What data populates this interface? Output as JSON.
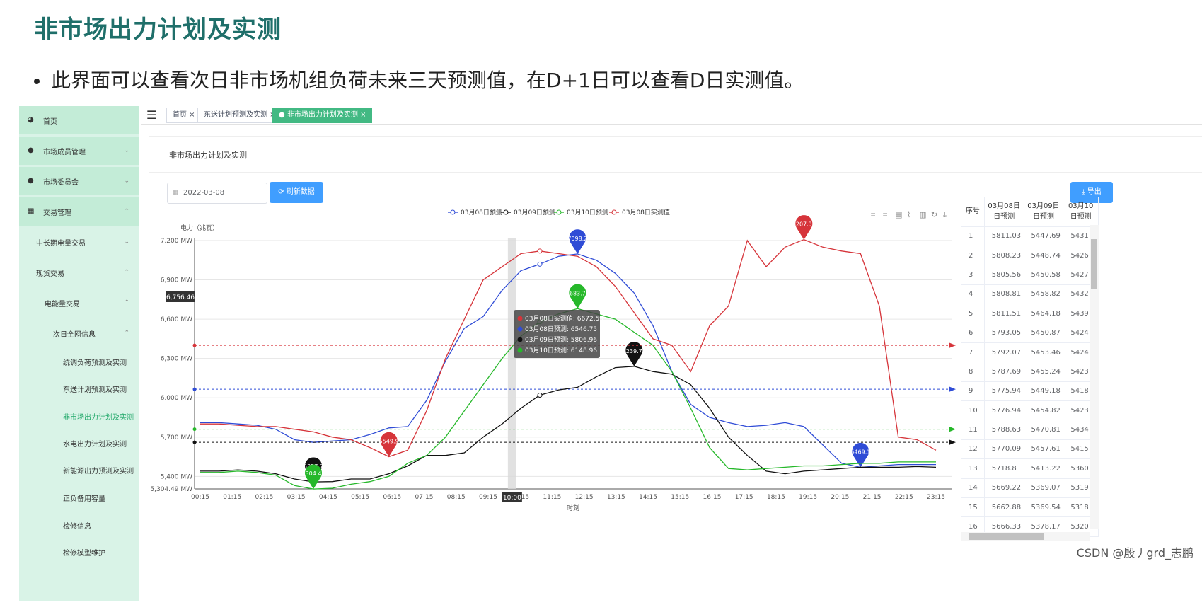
{
  "slide": {
    "title": "非市场出力计划及实测",
    "bullet": "此界面可以查看次日非市场机组负荷未来三天预测值，在D+1日可以查看D日实测值。"
  },
  "sidebar": {
    "items": [
      {
        "label": "首页",
        "icon": "dashboard-icon"
      },
      {
        "label": "市场成员管理",
        "icon": "people-icon",
        "chev": "⌄"
      },
      {
        "label": "市场委员会",
        "icon": "people-icon",
        "chev": "⌄"
      },
      {
        "label": "交易管理",
        "icon": "grid-icon",
        "chev": "⌃"
      },
      {
        "label": "中长期电量交易",
        "chev": "⌄"
      },
      {
        "label": "现货交易",
        "chev": "⌃"
      },
      {
        "label": "电能量交易",
        "chev": "⌃"
      },
      {
        "label": "次日全网信息",
        "chev": "⌃"
      },
      {
        "label": "统调负荷预测及实测"
      },
      {
        "label": "东送计划预测及实测"
      },
      {
        "label": "非市场出力计划及实测"
      },
      {
        "label": "水电出力计划及实测"
      },
      {
        "label": "新能源出力预测及实测"
      },
      {
        "label": "正负备用容量"
      },
      {
        "label": "检修信息"
      },
      {
        "label": "检修模型维护"
      }
    ]
  },
  "tabs": [
    {
      "label": "首页 ×"
    },
    {
      "label": "东送计划预测及实测 ×"
    },
    {
      "label": "● 非市场出力计划及实测 ×"
    }
  ],
  "panel": {
    "title": "非市场出力计划及实测",
    "date_value": "2022-03-08",
    "refresh_label": "刷新数据",
    "export_label": "导出"
  },
  "chart_data": {
    "type": "line",
    "ylabel": "电力（兆瓦）",
    "xlabel": "时刻",
    "x_ticks": [
      "00:15",
      "01:15",
      "02:15",
      "03:15",
      "04:15",
      "05:15",
      "06:15",
      "07:15",
      "08:15",
      "09:15",
      "10:15",
      "11:15",
      "12:15",
      "13:15",
      "14:15",
      "15:15",
      "16:15",
      "17:15",
      "18:15",
      "19:15",
      "20:15",
      "21:15",
      "22:15",
      "23:15"
    ],
    "y_ticks": [
      "7,200 MW",
      "6,900 MW",
      "6,600 MW",
      "6,300 MW",
      "6,000 MW",
      "5,700 MW",
      "5,400 MW"
    ],
    "ylim": [
      5304.49,
      7200
    ],
    "y_min_label": "5,304.49 MW",
    "pointer_label": "6,756.46",
    "axis_pointer_x": "10:00",
    "legend": [
      "03月08日预测",
      "03月09日预测",
      "03月10日预测",
      "03月08日实测值"
    ],
    "series": [
      {
        "name": "03月08日预测",
        "color": "#2f4cd6",
        "avg": 6065,
        "max_label": "7098.2",
        "min_label": "5469.1",
        "values": [
          5810,
          5810,
          5800,
          5790,
          5760,
          5680,
          5660,
          5670,
          5680,
          5720,
          5770,
          5780,
          5980,
          6280,
          6530,
          6620,
          6820,
          6970,
          7020,
          7080,
          7098,
          7050,
          6950,
          6800,
          6550,
          6200,
          5950,
          5850,
          5810,
          5780,
          5790,
          5810,
          5780,
          5640,
          5500,
          5469,
          5480,
          5490,
          5490,
          5490
        ]
      },
      {
        "name": "03月09日预测",
        "color": "#111111",
        "avg": 5660,
        "max_label": "6239.78",
        "min_label": "5357.7",
        "values": [
          5440,
          5440,
          5450,
          5440,
          5420,
          5380,
          5358,
          5360,
          5380,
          5380,
          5420,
          5480,
          5560,
          5560,
          5580,
          5700,
          5800,
          5920,
          6020,
          6060,
          6080,
          6160,
          6230,
          6240,
          6200,
          6180,
          6100,
          5920,
          5700,
          5560,
          5440,
          5420,
          5440,
          5450,
          5460,
          5470,
          5470,
          5470,
          5475,
          5470
        ]
      },
      {
        "name": "03月10日预测",
        "color": "#26b82a",
        "avg": 5760,
        "max_label": "6683.73",
        "min_label": "5304.49",
        "values": [
          5430,
          5430,
          5440,
          5430,
          5410,
          5330,
          5304,
          5310,
          5340,
          5360,
          5400,
          5500,
          5560,
          5700,
          5900,
          6100,
          6300,
          6470,
          6580,
          6640,
          6680,
          6640,
          6600,
          6500,
          6400,
          6200,
          5920,
          5620,
          5460,
          5450,
          5460,
          5470,
          5480,
          5480,
          5490,
          5500,
          5500,
          5510,
          5510,
          5510
        ]
      },
      {
        "name": "03月08日实测值",
        "color": "#d6343a",
        "avg": 6400,
        "max_label": "7207.33",
        "min_label": "5549.9",
        "values": [
          5800,
          5800,
          5790,
          5780,
          5780,
          5760,
          5740,
          5700,
          5680,
          5620,
          5550,
          5600,
          5900,
          6300,
          6600,
          6900,
          7000,
          7100,
          7120,
          7100,
          7080,
          7000,
          6850,
          6650,
          6450,
          6400,
          6200,
          6550,
          6700,
          7200,
          7000,
          7150,
          7207,
          7150,
          7120,
          7100,
          6700,
          5700,
          5680,
          5600
        ]
      }
    ],
    "tooltip": [
      {
        "text": "03月08日实测值: 6672.59",
        "color": "#d6343a"
      },
      {
        "text": "03月08日预测: 6546.75",
        "color": "#2f4cd6"
      },
      {
        "text": "03月09日预测: 5806.96",
        "color": "#111111"
      },
      {
        "text": "03月10日预测: 6148.96",
        "color": "#26b82a"
      }
    ]
  },
  "table": {
    "headers": [
      "序号",
      "03月08日\n日预测",
      "03月09日\n日预测",
      "03月10\n日预测"
    ],
    "rows": [
      [
        "1",
        "5811.03",
        "5447.69",
        "5431"
      ],
      [
        "2",
        "5808.23",
        "5448.74",
        "5426"
      ],
      [
        "3",
        "5805.56",
        "5450.58",
        "5427"
      ],
      [
        "4",
        "5808.81",
        "5458.82",
        "5432"
      ],
      [
        "5",
        "5811.51",
        "5464.18",
        "5439"
      ],
      [
        "6",
        "5793.05",
        "5450.87",
        "5424"
      ],
      [
        "7",
        "5792.07",
        "5453.46",
        "5424"
      ],
      [
        "8",
        "5787.69",
        "5455.24",
        "5423"
      ],
      [
        "9",
        "5775.94",
        "5449.18",
        "5418"
      ],
      [
        "10",
        "5776.94",
        "5454.82",
        "5423"
      ],
      [
        "11",
        "5788.63",
        "5470.81",
        "5434"
      ],
      [
        "12",
        "5770.09",
        "5457.61",
        "5415"
      ],
      [
        "13",
        "5718.8",
        "5413.22",
        "5360"
      ],
      [
        "14",
        "5669.22",
        "5369.07",
        "5319"
      ],
      [
        "15",
        "5662.88",
        "5369.54",
        "5318"
      ],
      [
        "16",
        "5666.33",
        "5378.17",
        "5320"
      ]
    ]
  },
  "watermark": "CSDN @殷丿grd_志鹏"
}
